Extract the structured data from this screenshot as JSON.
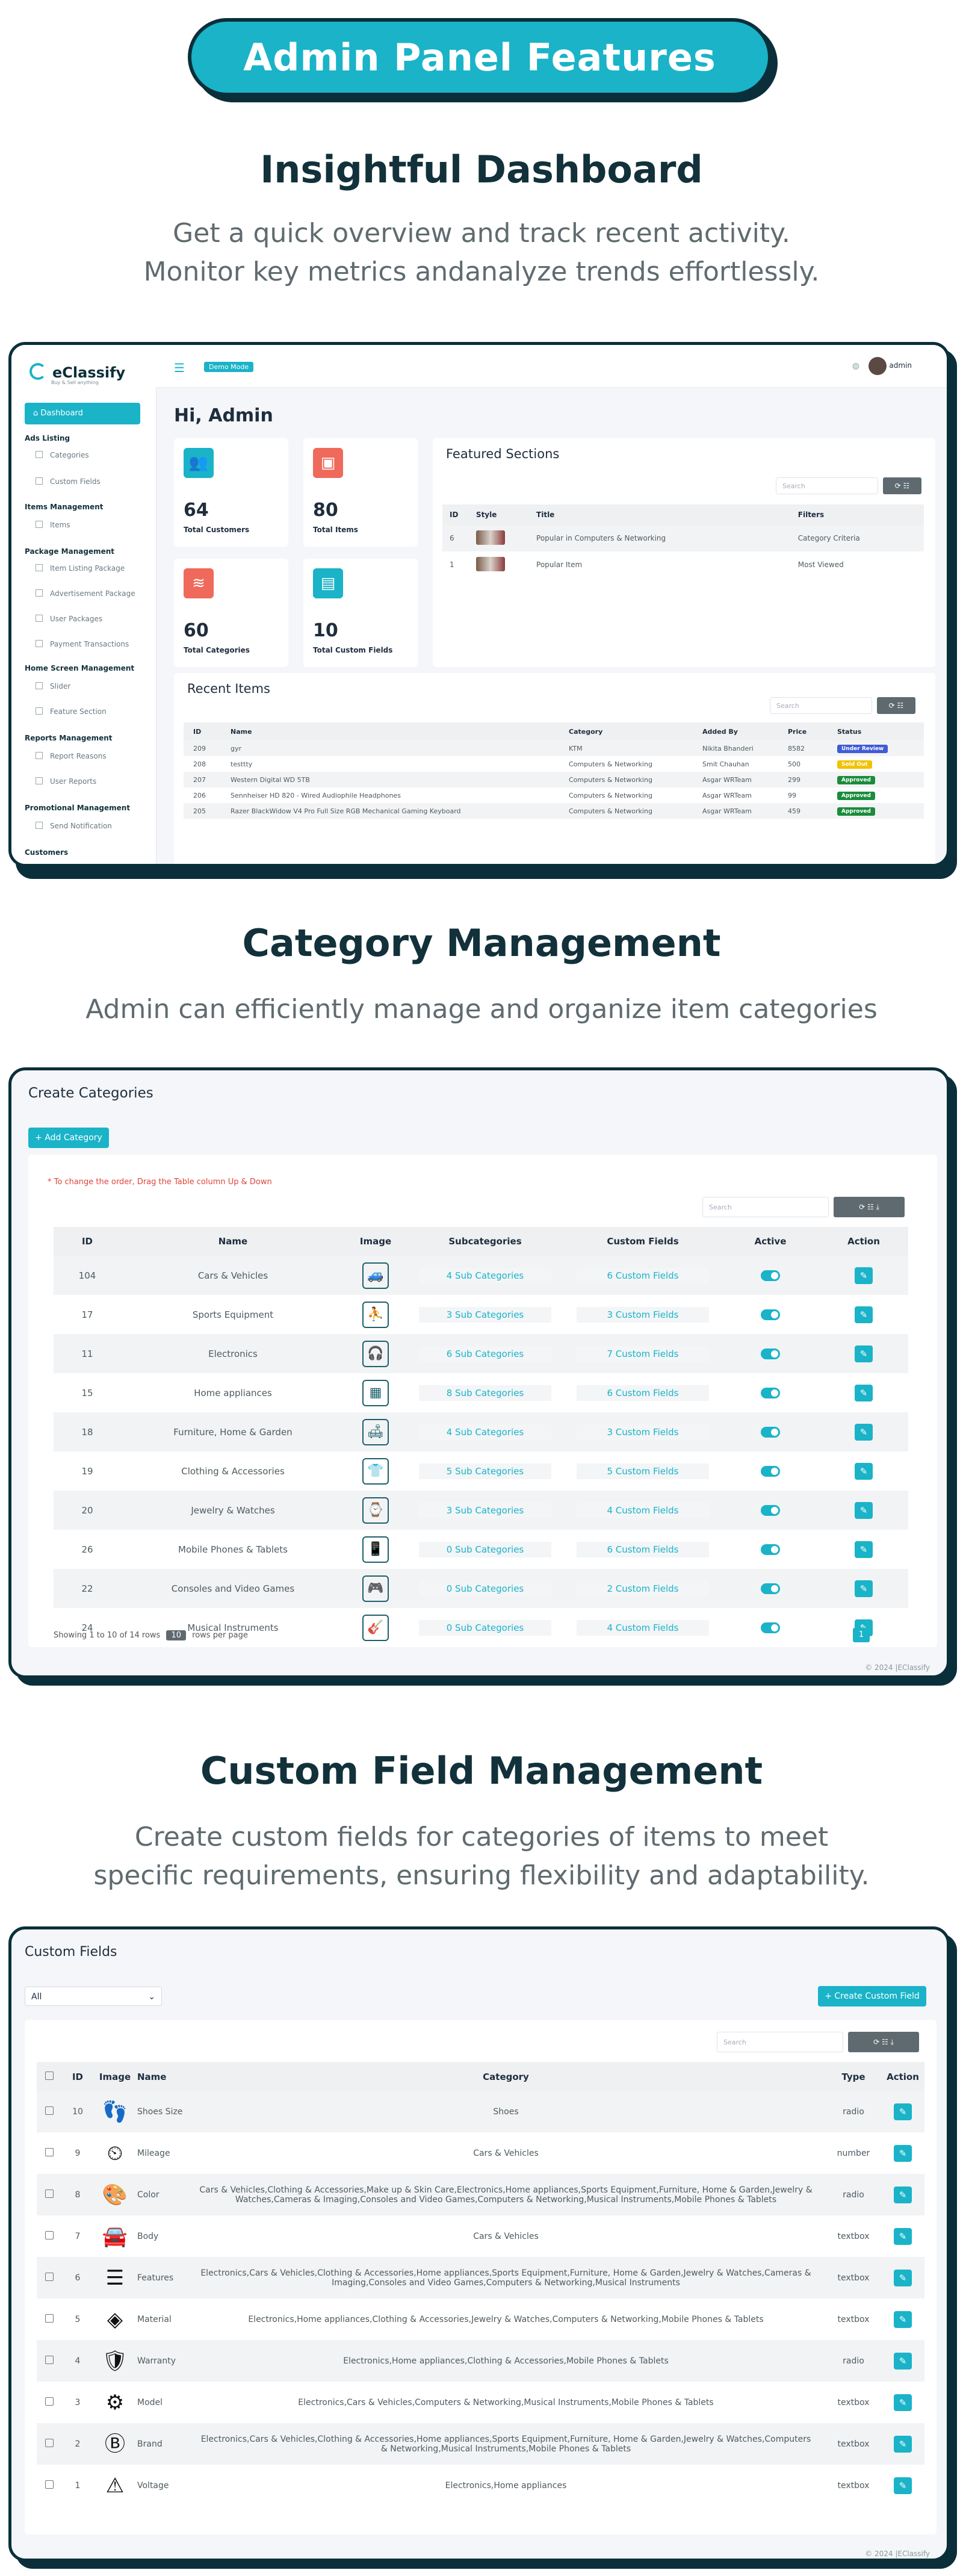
{
  "header": {
    "title": "Admin Panel Features"
  },
  "sections": [
    {
      "title": "Insightful Dashboard",
      "subtitle_lines": [
        "Get a quick overview and track recent activity.",
        "Monitor key metrics andanalyze trends effortlessly."
      ]
    },
    {
      "title": "Category Management",
      "subtitle_lines": [
        "Admin can efficiently manage and organize item categories"
      ]
    },
    {
      "title": "Custom Field Management",
      "subtitle_lines": [
        "Create custom fields for categories of items to meet",
        "specific requirements, ensuring flexibility and adaptability."
      ]
    }
  ],
  "dashboard": {
    "brand": "eClassify",
    "brand_tag": "Buy & Sell anything",
    "demo_badge": "Demo Mode",
    "user": "admin",
    "greeting": "Hi, Admin",
    "sidebar": {
      "active": "Dashboard",
      "groups": [
        {
          "label": "Ads Listing",
          "items": [
            "Categories",
            "Custom Fields"
          ]
        },
        {
          "label": "Items Management",
          "items": [
            "Items"
          ]
        },
        {
          "label": "Package Management",
          "items": [
            "Item Listing Package",
            "Advertisement Package",
            "User Packages",
            "Payment Transactions"
          ]
        },
        {
          "label": "Home Screen Management",
          "items": [
            "Slider",
            "Feature Section"
          ]
        },
        {
          "label": "Reports Management",
          "items": [
            "Report Reasons",
            "User Reports"
          ]
        },
        {
          "label": "Promotional Management",
          "items": [
            "Send Notification"
          ]
        },
        {
          "label": "Customers",
          "items": []
        }
      ]
    },
    "stats": [
      {
        "value": "64",
        "label": "Total Customers",
        "color": "#1ab3c8",
        "icon": "users-icon"
      },
      {
        "value": "80",
        "label": "Total Items",
        "color": "#ef6a5a",
        "icon": "box-icon"
      },
      {
        "value": "60",
        "label": "Total Categories",
        "color": "#ef6a5a",
        "icon": "layers-icon"
      },
      {
        "value": "10",
        "label": "Total Custom Fields",
        "color": "#1ab3c8",
        "icon": "fields-icon"
      }
    ],
    "featured": {
      "title": "Featured Sections",
      "search_placeholder": "Search",
      "columns": [
        "ID",
        "Style",
        "Title",
        "Filters"
      ],
      "rows": [
        {
          "id": "6",
          "title": "Popular in Computers & Networking",
          "filter": "Category Criteria"
        },
        {
          "id": "1",
          "title": "Popular Item",
          "filter": "Most Viewed"
        }
      ]
    },
    "recent": {
      "title": "Recent Items",
      "search_placeholder": "Search",
      "columns": [
        "ID",
        "Name",
        "Category",
        "Added By",
        "Price",
        "Status"
      ],
      "rows": [
        {
          "id": "209",
          "name": "gyr",
          "category": "KTM",
          "by": "Nikita Bhanderi",
          "price": "8582",
          "status": "Under Review",
          "status_color": "#3f5bd6"
        },
        {
          "id": "208",
          "name": "testtty",
          "category": "Computers & Networking",
          "by": "Smit Chauhan",
          "price": "500",
          "status": "Sold Out",
          "status_color": "#f2c200"
        },
        {
          "id": "207",
          "name": "Western Digital WD 5TB",
          "category": "Computers & Networking",
          "by": "Asgar WRTeam",
          "price": "299",
          "status": "Approved",
          "status_color": "#1a8c3c"
        },
        {
          "id": "206",
          "name": "Sennheiser HD 820 - Wired Audiophile Headphones",
          "category": "Computers & Networking",
          "by": "Asgar WRTeam",
          "price": "99",
          "status": "Approved",
          "status_color": "#1a8c3c"
        },
        {
          "id": "205",
          "name": "Razer BlackWidow V4 Pro Full Size RGB Mechanical Gaming Keyboard",
          "category": "Computers & Networking",
          "by": "Asgar WRTeam",
          "price": "459",
          "status": "Approved",
          "status_color": "#1a8c3c"
        }
      ]
    }
  },
  "categories": {
    "title": "Create Categories",
    "add_button": "+ Add Category",
    "note": "* To change the order, Drag the Table column Up & Down",
    "search_placeholder": "Search",
    "columns": [
      "ID",
      "Name",
      "Image",
      "Subcategories",
      "Custom Fields",
      "Active",
      "Action"
    ],
    "rows": [
      {
        "id": "104",
        "name": "Cars & Vehicles",
        "icon": "car-icon",
        "sub": "4 Sub Categories",
        "fields": "6 Custom Fields"
      },
      {
        "id": "17",
        "name": "Sports Equipment",
        "icon": "sports-icon",
        "sub": "3 Sub Categories",
        "fields": "3 Custom Fields"
      },
      {
        "id": "11",
        "name": "Electronics",
        "icon": "headphones-icon",
        "sub": "6 Sub Categories",
        "fields": "7 Custom Fields"
      },
      {
        "id": "15",
        "name": "Home appliances",
        "icon": "appliance-icon",
        "sub": "8 Sub Categories",
        "fields": "6 Custom Fields"
      },
      {
        "id": "18",
        "name": "Furniture, Home & Garden",
        "icon": "furniture-icon",
        "sub": "4 Sub Categories",
        "fields": "3 Custom Fields"
      },
      {
        "id": "19",
        "name": "Clothing & Accessories",
        "icon": "clothing-icon",
        "sub": "5 Sub Categories",
        "fields": "5 Custom Fields"
      },
      {
        "id": "20",
        "name": "Jewelry & Watches",
        "icon": "jewelry-icon",
        "sub": "3 Sub Categories",
        "fields": "4 Custom Fields"
      },
      {
        "id": "26",
        "name": "Mobile Phones & Tablets",
        "icon": "phone-icon",
        "sub": "0 Sub Categories",
        "fields": "6 Custom Fields"
      },
      {
        "id": "22",
        "name": "Consoles and Video Games",
        "icon": "console-icon",
        "sub": "0 Sub Categories",
        "fields": "2 Custom Fields"
      },
      {
        "id": "24",
        "name": "Musical Instruments",
        "icon": "guitar-icon",
        "sub": "0 Sub Categories",
        "fields": "4 Custom Fields"
      }
    ],
    "pagination_text": "Showing 1 to 10 of 14 rows",
    "per_page": "10",
    "per_page_suffix": "rows per page",
    "current_page": "1",
    "copyright": "© 2024 |EClassify"
  },
  "custom_fields": {
    "title": "Custom Fields",
    "filter_value": "All",
    "create_button": "+ Create Custom Field",
    "search_placeholder": "Search",
    "columns": [
      "ID",
      "Image",
      "Name",
      "Category",
      "Type",
      "Action"
    ],
    "rows": [
      {
        "id": "10",
        "icon": "shoe-size-icon",
        "glyph": "👣",
        "name": "Shoes Size",
        "category": "Shoes",
        "type": "radio"
      },
      {
        "id": "9",
        "icon": "mileage-icon",
        "glyph": "⏲",
        "name": "Mileage",
        "category": "Cars & Vehicles",
        "type": "number"
      },
      {
        "id": "8",
        "icon": "color-icon",
        "glyph": "🎨",
        "name": "Color",
        "category": "Cars & Vehicles,Clothing & Accessories,Make up & Skin Care,Electronics,Home appliances,Sports Equipment,Furniture, Home & Garden,Jewelry & Watches,Cameras & Imaging,Consoles and Video Games,Computers & Networking,Musical Instruments,Mobile Phones & Tablets",
        "type": "radio"
      },
      {
        "id": "7",
        "icon": "body-icon",
        "glyph": "🚘",
        "name": "Body",
        "category": "Cars & Vehicles",
        "type": "textbox"
      },
      {
        "id": "6",
        "icon": "features-icon",
        "glyph": "☰",
        "name": "Features",
        "category": "Electronics,Cars & Vehicles,Clothing & Accessories,Home appliances,Sports Equipment,Furniture, Home & Garden,Jewelry & Watches,Cameras & Imaging,Consoles and Video Games,Computers & Networking,Musical Instruments",
        "type": "textbox"
      },
      {
        "id": "5",
        "icon": "material-icon",
        "glyph": "◈",
        "name": "Material",
        "category": "Electronics,Home appliances,Clothing & Accessories,Jewelry & Watches,Computers & Networking,Mobile Phones & Tablets",
        "type": "textbox"
      },
      {
        "id": "4",
        "icon": "warranty-icon",
        "glyph": "🛡",
        "name": "Warranty",
        "category": "Electronics,Home appliances,Clothing & Accessories,Mobile Phones & Tablets",
        "type": "radio"
      },
      {
        "id": "3",
        "icon": "model-icon",
        "glyph": "⚙",
        "name": "Model",
        "category": "Electronics,Cars & Vehicles,Computers & Networking,Musical Instruments,Mobile Phones & Tablets",
        "type": "textbox"
      },
      {
        "id": "2",
        "icon": "brand-icon",
        "glyph": "Ⓑ",
        "name": "Brand",
        "category": "Electronics,Cars & Vehicles,Clothing & Accessories,Home appliances,Sports Equipment,Furniture, Home & Garden,Jewelry & Watches,Computers & Networking,Musical Instruments,Mobile Phones & Tablets",
        "type": "textbox"
      },
      {
        "id": "1",
        "icon": "voltage-icon",
        "glyph": "⚠",
        "name": "Voltage",
        "category": "Electronics,Home appliances",
        "type": "textbox"
      }
    ],
    "copyright": "© 2024 |EClassify"
  }
}
